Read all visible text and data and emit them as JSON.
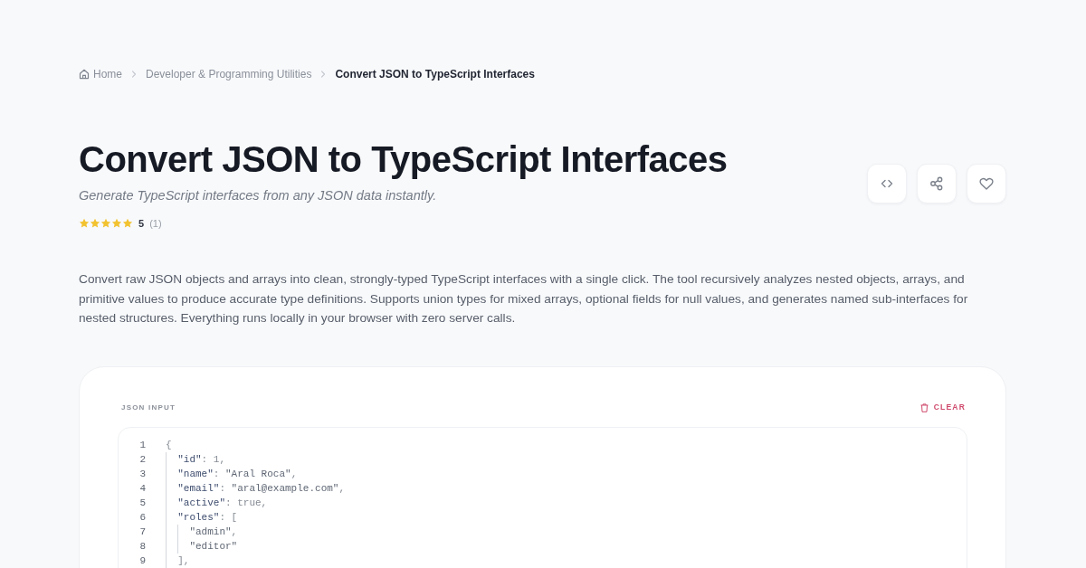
{
  "breadcrumb": [
    {
      "kind": "home",
      "label": "Home"
    },
    {
      "kind": "link",
      "label": "Developer & Programming Utilities"
    },
    {
      "kind": "current",
      "label": "Convert JSON to TypeScript Interfaces"
    }
  ],
  "header": {
    "title": "Convert JSON to TypeScript Interfaces",
    "subtitle": "Generate TypeScript interfaces from any JSON data instantly.",
    "rating": {
      "stars": 5,
      "score": "5",
      "count": "(1)"
    }
  },
  "description": "Convert raw JSON objects and arrays into clean, strongly-typed TypeScript interfaces with a single click. The tool recursively analyzes nested objects, arrays, and primitive values to produce accurate type definitions. Supports union types for mixed arrays, optional fields for null values, and generates named sub-interfaces for nested structures. Everything runs locally in your browser with zero server calls.",
  "editor": {
    "label": "JSON INPUT",
    "clear_button": "CLEAR",
    "lines": [
      {
        "number": "1",
        "tokens": [
          {
            "kind": "plain",
            "text": "{"
          }
        ],
        "children": [
          {
            "number": "2",
            "tokens": [
              {
                "kind": "key",
                "text": "\"id\""
              },
              {
                "kind": "plain",
                "text": ": 1,"
              }
            ]
          },
          {
            "number": "3",
            "tokens": [
              {
                "kind": "key",
                "text": "\"name\""
              },
              {
                "kind": "plain",
                "text": ": "
              },
              {
                "kind": "string",
                "text": "\"Aral Roca\""
              },
              {
                "kind": "plain",
                "text": ","
              }
            ]
          },
          {
            "number": "4",
            "tokens": [
              {
                "kind": "key",
                "text": "\"email\""
              },
              {
                "kind": "plain",
                "text": ": "
              },
              {
                "kind": "string",
                "text": "\"aral@example.com\""
              },
              {
                "kind": "plain",
                "text": ","
              }
            ]
          },
          {
            "number": "5",
            "tokens": [
              {
                "kind": "key",
                "text": "\"active\""
              },
              {
                "kind": "plain",
                "text": ": true,"
              }
            ]
          },
          {
            "number": "6",
            "tokens": [
              {
                "kind": "key",
                "text": "\"roles\""
              },
              {
                "kind": "plain",
                "text": ": ["
              }
            ],
            "children": [
              {
                "number": "7",
                "tokens": [
                  {
                    "kind": "string",
                    "text": "\"admin\""
                  },
                  {
                    "kind": "plain",
                    "text": ","
                  }
                ]
              },
              {
                "number": "8",
                "tokens": [
                  {
                    "kind": "string",
                    "text": "\"editor\""
                  }
                ]
              }
            ]
          },
          {
            "number": "9",
            "tokens": [
              {
                "kind": "plain",
                "text": "],"
              }
            ]
          }
        ]
      }
    ]
  }
}
